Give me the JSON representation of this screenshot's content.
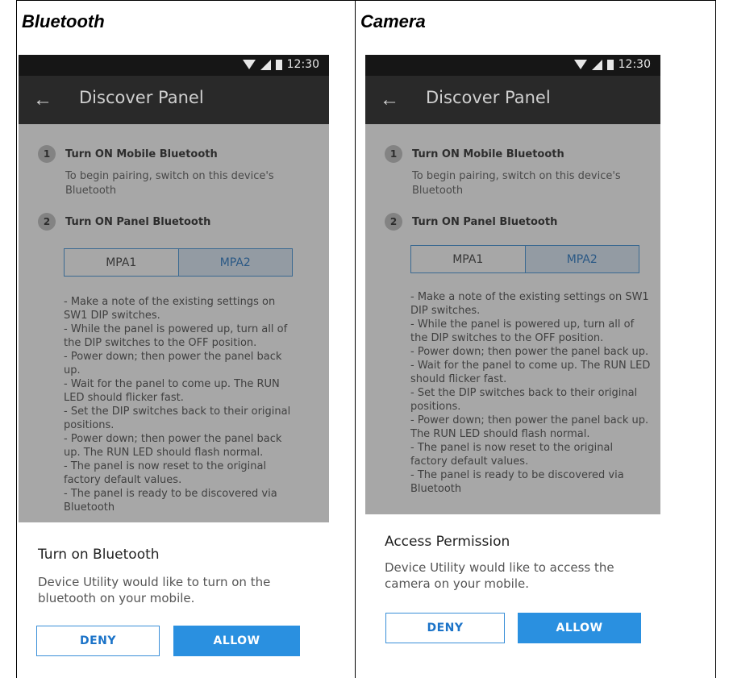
{
  "columns": [
    {
      "heading": "Bluetooth",
      "status_time": "12:30",
      "app_title": "Discover Panel",
      "step1": {
        "number": "1",
        "title": "Turn ON Mobile Bluetooth",
        "desc": "To begin pairing, switch on this device's Bluetooth"
      },
      "step2": {
        "number": "2",
        "title": "Turn ON Panel Bluetooth"
      },
      "tabs": [
        "MPA1",
        "MPA2"
      ],
      "selected_tab": "MPA2",
      "instructions": [
        "- Make a note of the existing settings on SW1 DIP switches.",
        "- While the panel is powered up, turn all of the DIP switches to the OFF position.",
        "- Power down; then power the panel back up.",
        "- Wait for the panel to come up. The RUN LED should flicker fast.",
        "- Set the DIP switches back to their original positions.",
        "- Power down; then power the panel back up. The RUN LED should flash normal.",
        "- The panel is now reset to the original factory default values.",
        "- The panel is ready to be discovered via Bluetooth"
      ],
      "dialog": {
        "title": "Turn on Bluetooth",
        "body": "Device Utility would like to turn on the bluetooth on your mobile.",
        "deny": "DENY",
        "allow": "ALLOW"
      }
    },
    {
      "heading": "Camera",
      "status_time": "12:30",
      "app_title": "Discover Panel",
      "step1": {
        "number": "1",
        "title": "Turn ON Mobile Bluetooth",
        "desc": "To begin pairing, switch on this device's Bluetooth"
      },
      "step2": {
        "number": "2",
        "title": "Turn ON Panel Bluetooth"
      },
      "tabs": [
        "MPA1",
        "MPA2"
      ],
      "selected_tab": "MPA2",
      "instructions": [
        "- Make a note of the existing settings on SW1 DIP switches.",
        "- While the panel is powered up, turn all of the DIP switches to the OFF position.",
        "- Power down; then power the panel back up.",
        "- Wait for the panel to come up. The RUN LED should flicker fast.",
        "- Set the DIP switches back to their original positions.",
        "- Power down; then power the panel back up. The RUN LED should flash normal.",
        "- The panel is now reset to the original factory default values.",
        "- The panel is ready to be discovered via Bluetooth"
      ],
      "dialog": {
        "title": "Access Permission",
        "body": "Device Utility would like to access the camera on your mobile.",
        "deny": "DENY",
        "allow": "ALLOW"
      }
    }
  ]
}
